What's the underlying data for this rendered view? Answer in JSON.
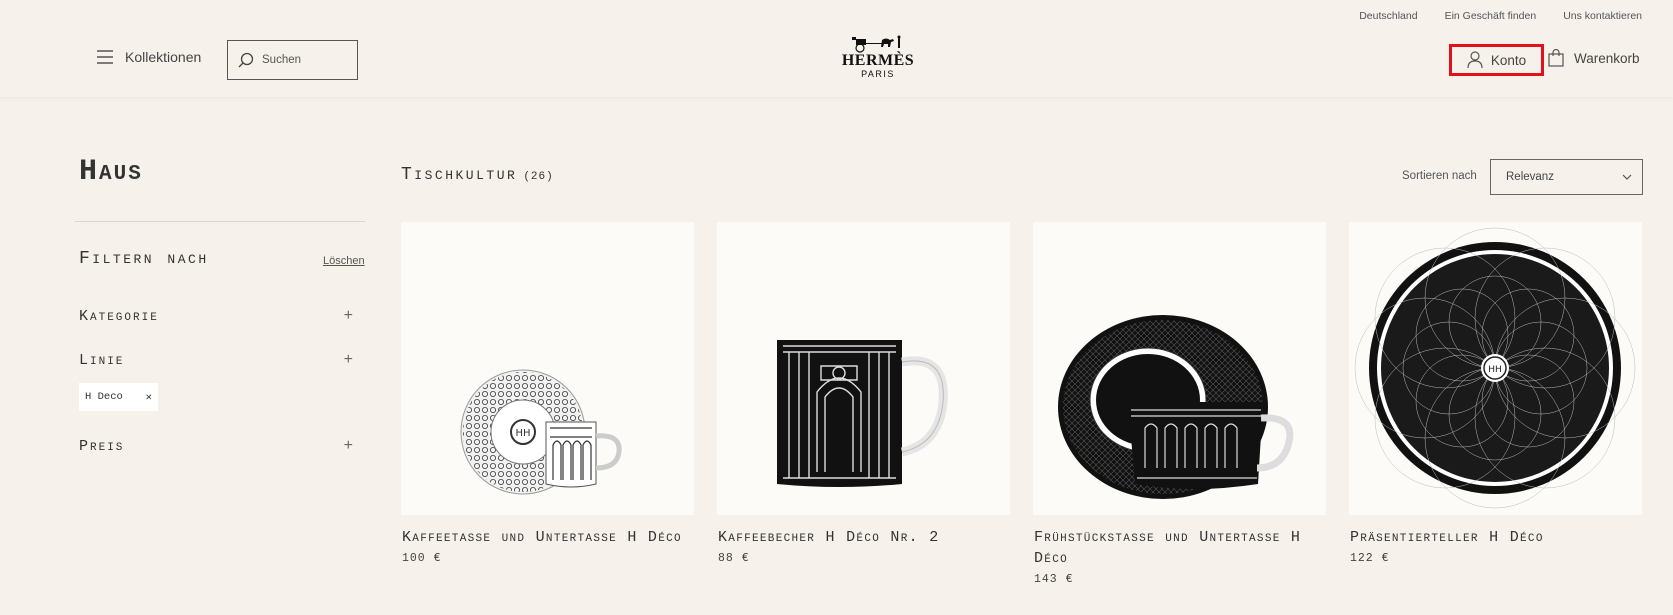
{
  "header": {
    "utility_links": [
      "Deutschland",
      "Ein Geschäft finden",
      "Uns kontaktieren"
    ],
    "menu_label": "Kollektionen",
    "search_placeholder": "Suchen",
    "logo": {
      "word": "HERMÈS",
      "sub": "PARIS"
    },
    "account_label": "Konto",
    "cart_label": "Warenkorb"
  },
  "sidebar": {
    "page_title": "Haus",
    "filter_title": "Filtern nach",
    "clear_label": "Löschen",
    "facets": [
      {
        "label": "Kategorie",
        "toggle": "+"
      },
      {
        "label": "Linie",
        "toggle": "+"
      },
      {
        "label": "Preis",
        "toggle": "+"
      }
    ],
    "active_chip": {
      "label": "H Deco",
      "remove": "✕"
    }
  },
  "main": {
    "section_title": "Tischkultur",
    "count": "(26)",
    "sort_label": "Sortieren nach",
    "sort_value": "Relevanz",
    "products": [
      {
        "name": "Kaffeetasse und Untertasse H Déco",
        "price": "100 €",
        "image": "espresso-cup-saucer"
      },
      {
        "name": "Kaffeebecher H Déco Nr. 2",
        "price": "88 €",
        "image": "mug"
      },
      {
        "name": "Frühstückstasse und Untertasse H Déco",
        "price": "143 €",
        "image": "breakfast-cup-saucer"
      },
      {
        "name": "Präsentierteller H Déco",
        "price": "122 €",
        "image": "presentation-plate"
      }
    ]
  },
  "colors": {
    "background": "#f6f1eb",
    "card_bg": "#fdfbf7",
    "highlight": "#e0111b"
  }
}
